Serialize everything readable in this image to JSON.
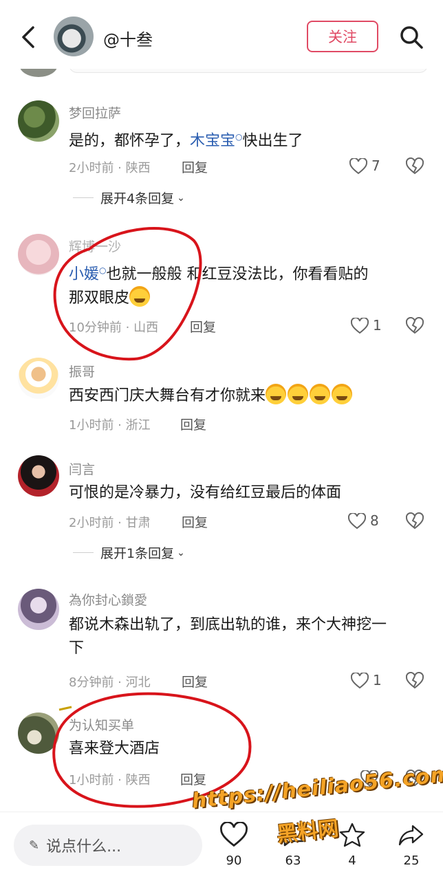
{
  "header": {
    "username": "@十叁",
    "follow_label": "关注"
  },
  "comments": [
    {
      "name": "梦回拉萨",
      "text_before": "是的，都怀孕了，",
      "text_link": "木宝宝",
      "text_after": "快出生了",
      "time": "2小时前 · 陕西",
      "reply": "回复",
      "likes": "7",
      "expand": "展开4条回复"
    },
    {
      "name": "辉博一沙",
      "text_link": "小媛",
      "text_after": "也就一般般   和红豆没法比，你看看贴的",
      "text_line2": "那双眼皮",
      "time": "10分钟前 · 山西",
      "reply": "回复",
      "likes": "1"
    },
    {
      "name": "振哥",
      "text": "西安西门庆大舞台有才你就来",
      "time": "1小时前 · 浙江",
      "reply": "回复"
    },
    {
      "name": "闫言",
      "text": "可恨的是冷暴力，没有给红豆最后的体面",
      "time": "2小时前 · 甘肃",
      "reply": "回复",
      "likes": "8",
      "expand": "展开1条回复"
    },
    {
      "name": "為你封心鎖愛",
      "text": "都说木森出轨了，到底出轨的谁，来个大神挖一",
      "text_line2": "下",
      "time": "8分钟前 · 河北",
      "reply": "回复",
      "likes": "1"
    },
    {
      "name": "为认知买单",
      "text": "喜来登大酒店",
      "time": "1小时前 · 陕西",
      "reply": "回复"
    }
  ],
  "bottom": {
    "placeholder": "说点什么...",
    "like_count": "90",
    "comment_count": "63",
    "star_count": "4",
    "share_count": "25"
  },
  "watermark": {
    "url": "https://heiliao56.com",
    "name": "黑料网"
  },
  "colors": {
    "accent": "#e04a64",
    "link": "#2a5db0",
    "annotation": "#d8141b",
    "watermark": "#f4a326"
  }
}
